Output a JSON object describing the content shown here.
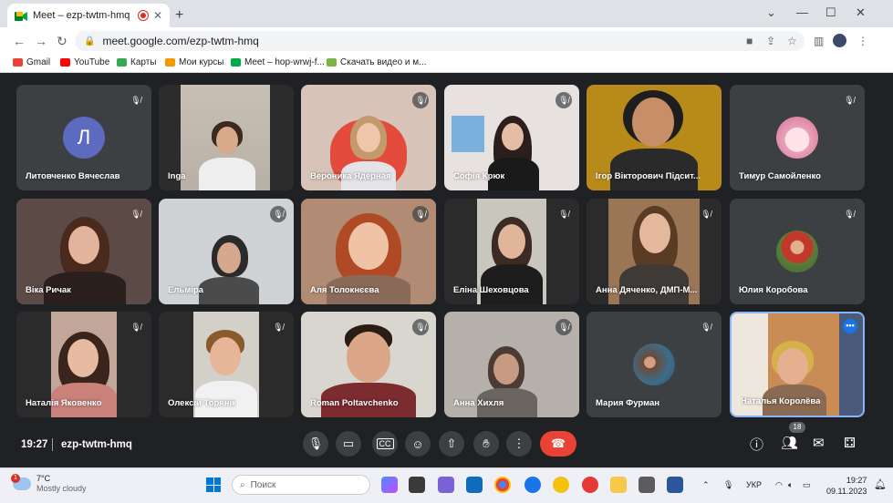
{
  "browser": {
    "tab_title": "Meet – ezp-twtm-hmq",
    "url": "meet.google.com/ezp-twtm-hmq",
    "new_tab_symbol": "+",
    "bookmarks": [
      "Gmail",
      "YouTube",
      "Карты",
      "Мои курсы",
      "Meet – hop-wrwj-f...",
      "Скачать видео и м..."
    ]
  },
  "participants": [
    {
      "name": "Литовченко Вячеслав",
      "avatar_letter": "Л"
    },
    {
      "name": "Inga"
    },
    {
      "name": "Вероника Ядерная"
    },
    {
      "name": "Софія Крюк"
    },
    {
      "name": "Ігор Вікторович Підсит..."
    },
    {
      "name": "Тимур Самойленко"
    },
    {
      "name": "Віка Ричак"
    },
    {
      "name": "Ельміра"
    },
    {
      "name": "Аля Толокнєєва"
    },
    {
      "name": "Еліна Шеховцова"
    },
    {
      "name": "Анна Дяченко, ДМП-М..."
    },
    {
      "name": "Юлия Коробова"
    },
    {
      "name": "Наталія Яковенко"
    },
    {
      "name": "Олексій Торянік"
    },
    {
      "name": "Roman Poltavchenko"
    },
    {
      "name": "Анна Хихля"
    },
    {
      "name": "Мария Фурман"
    },
    {
      "name": "Наталья Королёва"
    }
  ],
  "meeting": {
    "time": "19:27",
    "code": "ezp-twtm-hmq",
    "participant_count": "18"
  },
  "taskbar": {
    "temperature": "7°C",
    "condition": "Mostly cloudy",
    "weather_alert": "1",
    "search_placeholder": "Поиск",
    "language": "УКР",
    "clock_time": "19:27",
    "clock_date": "09.11.2023"
  },
  "colors": {
    "meet_bg": "#202124",
    "tile_bg": "#3c4043",
    "end_call": "#ea4335",
    "accent": "#1a73e8"
  }
}
